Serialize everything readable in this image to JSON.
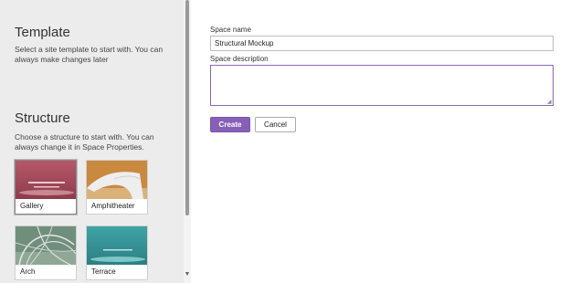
{
  "sidebar": {
    "template": {
      "title": "Template",
      "description": "Select a site template to start with. You can always make changes later"
    },
    "structure": {
      "title": "Structure",
      "description": "Choose a structure to start with. You can always change it in Space Properties.",
      "tiles": [
        {
          "label": "Gallery",
          "selected": true
        },
        {
          "label": "Amphitheater",
          "selected": false
        },
        {
          "label": "Arch",
          "selected": false
        },
        {
          "label": "Terrace",
          "selected": false
        }
      ]
    }
  },
  "form": {
    "space_name_label": "Space name",
    "space_name_value": "Structural Mockup",
    "space_description_label": "Space description",
    "space_description_value": "",
    "create_label": "Create",
    "cancel_label": "Cancel"
  },
  "colors": {
    "accent": "#8660b7"
  }
}
